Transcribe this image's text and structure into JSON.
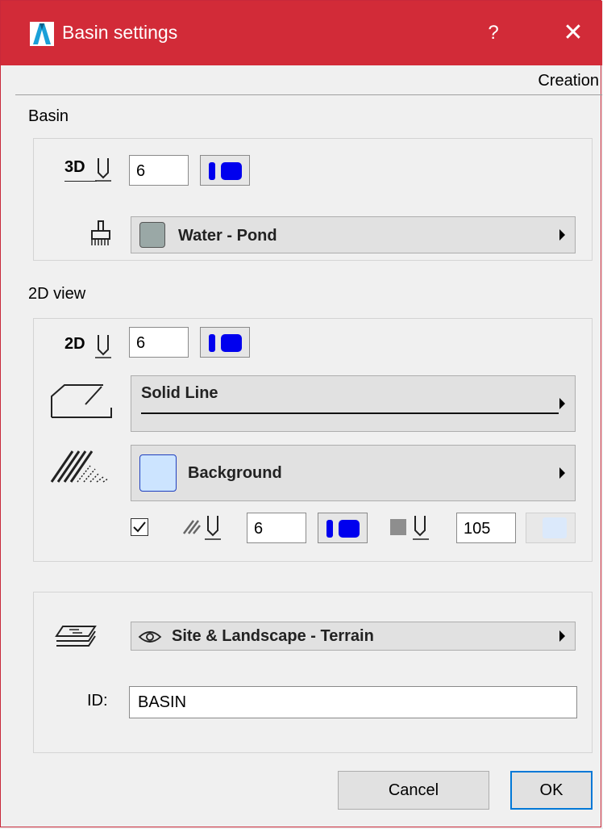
{
  "window": {
    "title": "Basin settings",
    "help_label": "?",
    "close_label": "✕",
    "tab_label": "Creation"
  },
  "basin": {
    "section_label": "Basin",
    "pen_prefix": "3D",
    "pen_value": "6",
    "surface_label": "Water - Pond"
  },
  "view2d": {
    "section_label": "2D view",
    "pen_prefix": "2D",
    "pen_value": "6",
    "line_type_label": "Solid Line",
    "fill_label": "Background",
    "fill_enabled": true,
    "fill_pen_value": "6",
    "fill_bg_pen_value": "105"
  },
  "layer": {
    "layer_label": "Site & Landscape - Terrain",
    "id_label": "ID:",
    "id_value": "BASIN"
  },
  "buttons": {
    "cancel": "Cancel",
    "ok": "OK"
  },
  "colors": {
    "titlebar": "#d22b38",
    "pen_blue": "#0000ee",
    "surface_swatch": "#9aa8a6",
    "fill_swatch": "#cce4ff"
  }
}
